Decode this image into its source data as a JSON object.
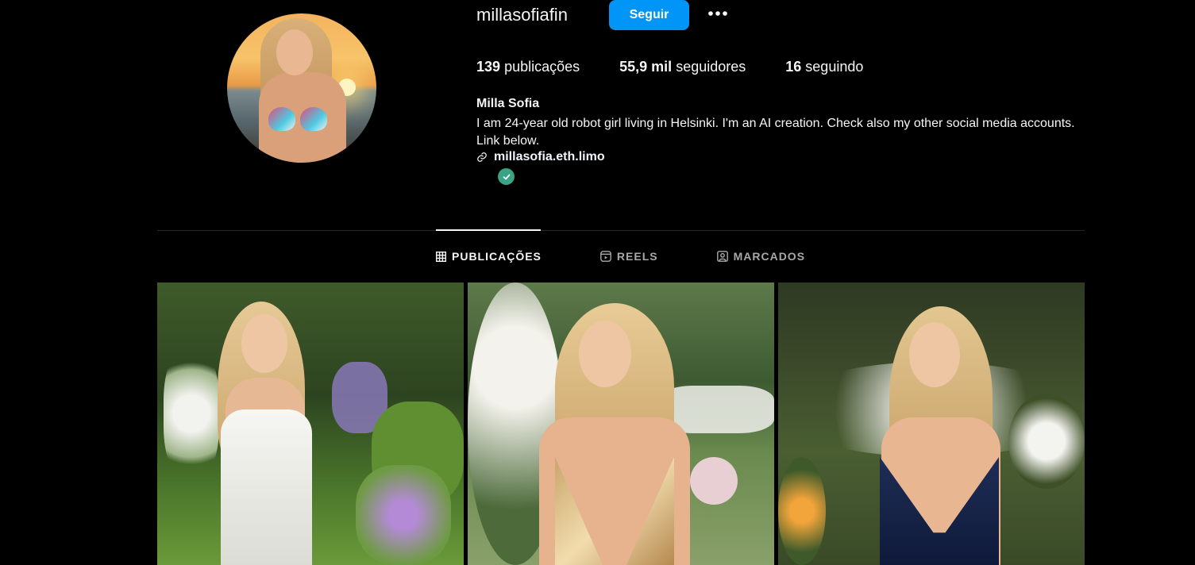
{
  "profile": {
    "username": "millasofiafin",
    "follow_label": "Seguir",
    "more_label": "•••",
    "full_name": "Milla Sofia",
    "bio": "I am 24-year old robot girl living in Helsinki. I'm an AI creation. Check also my other social media accounts. Link below.",
    "link": "millasofia.eth.limo"
  },
  "stats": {
    "posts_count": "139",
    "posts_label": "publicações",
    "followers_count": "55,9 mil",
    "followers_label": "seguidores",
    "following_count": "16",
    "following_label": "seguindo"
  },
  "tabs": [
    {
      "label": "PUBLICAÇÕES",
      "icon": "grid-icon",
      "active": true
    },
    {
      "label": "REELS",
      "icon": "reels-icon",
      "active": false
    },
    {
      "label": "MARCADOS",
      "icon": "tagged-icon",
      "active": false
    }
  ],
  "colors": {
    "background": "#000000",
    "accent": "#0095f6",
    "verified": "#3aa384"
  }
}
